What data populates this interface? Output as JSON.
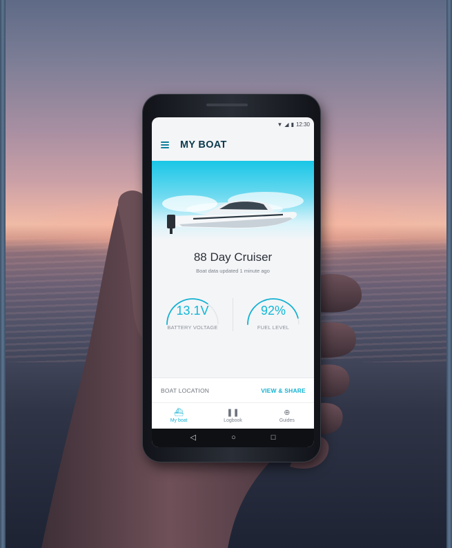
{
  "status_bar": {
    "time": "12:30",
    "icons": [
      "wifi-icon",
      "signal-icon",
      "battery-icon"
    ]
  },
  "app": {
    "title": "MY BOAT",
    "boat_name": "88 Day Cruiser",
    "updated_text": "Boat data updated 1 minute ago"
  },
  "gauges": [
    {
      "value": "13.1V",
      "label": "BATTERY VOLTAGE",
      "fill_fraction": 0.7
    },
    {
      "value": "92%",
      "label": "FUEL LEVEL",
      "fill_fraction": 0.92
    }
  ],
  "location": {
    "label": "BOAT LOCATION",
    "action": "VIEW & SHARE"
  },
  "bottom_nav": [
    {
      "label": "My boat",
      "icon": "boat-icon",
      "active": true
    },
    {
      "label": "Logbook",
      "icon": "book-icon",
      "active": false
    },
    {
      "label": "Guides",
      "icon": "lifebuoy-icon",
      "active": false
    }
  ],
  "system_nav": [
    "back-icon",
    "home-icon",
    "recents-icon"
  ],
  "colors": {
    "accent": "#13b2d2",
    "title": "#0b3a4d",
    "hero": "#19c6e6"
  }
}
